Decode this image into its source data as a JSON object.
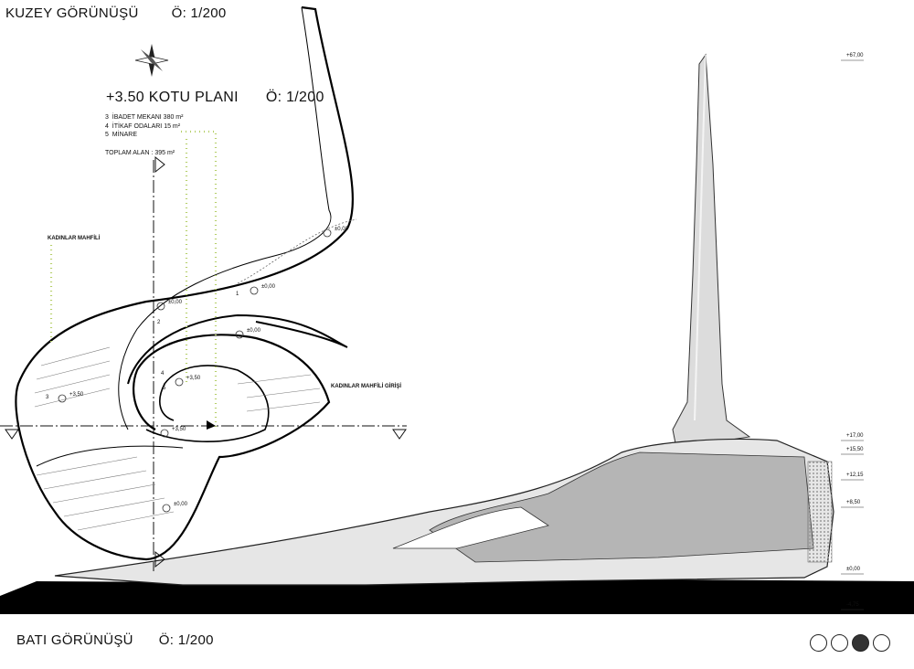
{
  "north_elevation": {
    "title": "KUZEY GÖRÜNÜŞÜ",
    "scale": "Ö: 1/200"
  },
  "plan": {
    "title": "+3.50 KOTU PLANI",
    "scale": "Ö: 1/200",
    "legend": [
      {
        "num": "3",
        "text": "İBADET MEKANI 380 m²"
      },
      {
        "num": "4",
        "text": "İTİKAF ODALARI  15 m²"
      },
      {
        "num": "5",
        "text": "MİNARE"
      }
    ],
    "total": "TOPLAM ALAN : 395 m²",
    "labels": {
      "womens_gallery": "KADINLAR MAHFİLİ",
      "womens_gallery_entrance": "KADINLAR MAHFİLİ GİRİŞİ"
    },
    "levels": {
      "a": "±0,00",
      "b": "±0,00",
      "c": "±0,00",
      "d": "±0,00",
      "e": "+3,50",
      "f": "+3,50",
      "g": "+3,50",
      "h": "±0,00"
    },
    "room_numbers": [
      "1",
      "2",
      "3",
      "4",
      "5"
    ]
  },
  "west_elevation": {
    "title": "BATI GÖRÜNÜŞÜ",
    "scale": "Ö: 1/200",
    "levels": [
      "+67,00",
      "+17,00",
      "+15,50",
      "+12,15",
      "+8,50",
      "±0,00",
      "-4,75"
    ]
  },
  "pager": {
    "total": 4,
    "active": 3
  },
  "icons": {
    "north_arrow": "north-arrow-icon"
  },
  "colors": {
    "accent_dotted": "#b6cf6a",
    "ground": "#000000",
    "surface": "#e6e6e6"
  }
}
